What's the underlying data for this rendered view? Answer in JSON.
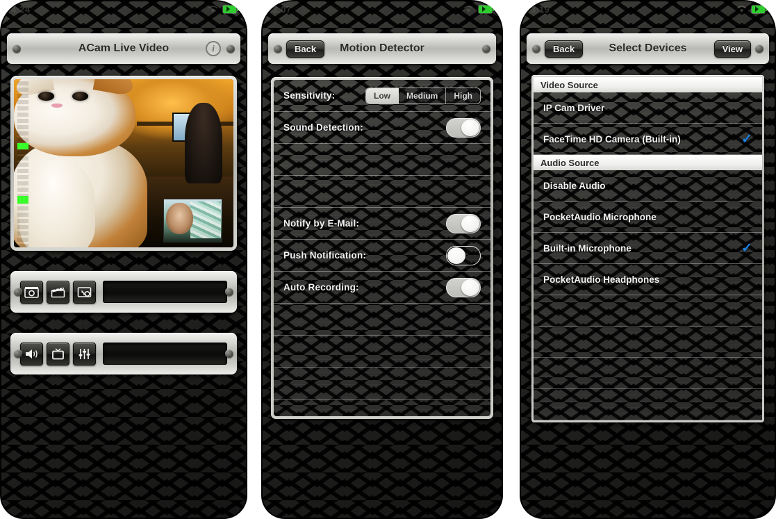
{
  "app": {
    "name": "ACam",
    "accent_blue": "#1a84e8",
    "battery_green": "#2ecc2e"
  },
  "panels": [
    {
      "id": "live-video",
      "status": {
        "time": "4:24",
        "wifi": "wifi-icon",
        "battery": "battery-charging-icon"
      },
      "nav": {
        "title": "ACam Live Video",
        "info_label": "i"
      },
      "video": {
        "caption": "live camera preview",
        "pip_caption": "picture-in-picture preview"
      },
      "toolbar_top": {
        "buttons": [
          {
            "name": "snapshot-button",
            "icon": "camera-icon"
          },
          {
            "name": "video-clip-button",
            "icon": "clapperboard-icon"
          },
          {
            "name": "record-button",
            "icon": "screen-record-icon"
          }
        ]
      },
      "toolbar_bottom": {
        "buttons": [
          {
            "name": "audio-button",
            "icon": "speaker-icon"
          },
          {
            "name": "fullscreen-button",
            "icon": "tv-icon"
          },
          {
            "name": "settings-button",
            "icon": "sliders-icon"
          }
        ]
      }
    },
    {
      "id": "motion-detector",
      "status": {
        "time": "3:07",
        "wifi": "wifi-icon",
        "battery": "battery-charging-icon"
      },
      "nav": {
        "back_label": "Back",
        "title": "Motion Detector"
      },
      "rows": [
        {
          "label": "Sensitivity:",
          "control": "segmented",
          "options": [
            "Low",
            "Medium",
            "High"
          ],
          "selected": "Low"
        },
        {
          "label": "Sound Detection:",
          "control": "switch",
          "value": "on"
        },
        {
          "label": "",
          "control": "none",
          "value": ""
        },
        {
          "label": "Notify by E-Mail:",
          "control": "switch",
          "value": "on"
        },
        {
          "label": "Push Notification:",
          "control": "switch",
          "value": "off"
        },
        {
          "label": "Auto Recording:",
          "control": "switch",
          "value": "on"
        }
      ]
    },
    {
      "id": "select-devices",
      "status": {
        "time": "3:19",
        "wifi": "wifi-icon",
        "battery": "battery-charging-icon"
      },
      "nav": {
        "back_label": "Back",
        "title": "Select Devices",
        "view_label": "View"
      },
      "sections": [
        {
          "header": "Video Source",
          "items": [
            {
              "label": "IP Cam Driver",
              "checked": false
            },
            {
              "label": "FaceTime HD Camera (Built-in)",
              "checked": true
            }
          ]
        },
        {
          "header": "Audio Source",
          "items": [
            {
              "label": "Disable Audio",
              "checked": false
            },
            {
              "label": "PocketAudio Microphone",
              "checked": false
            },
            {
              "label": "Built-in Microphone",
              "checked": true
            },
            {
              "label": "PocketAudio Headphones",
              "checked": false
            }
          ]
        }
      ],
      "check_glyph": "✓"
    }
  ]
}
